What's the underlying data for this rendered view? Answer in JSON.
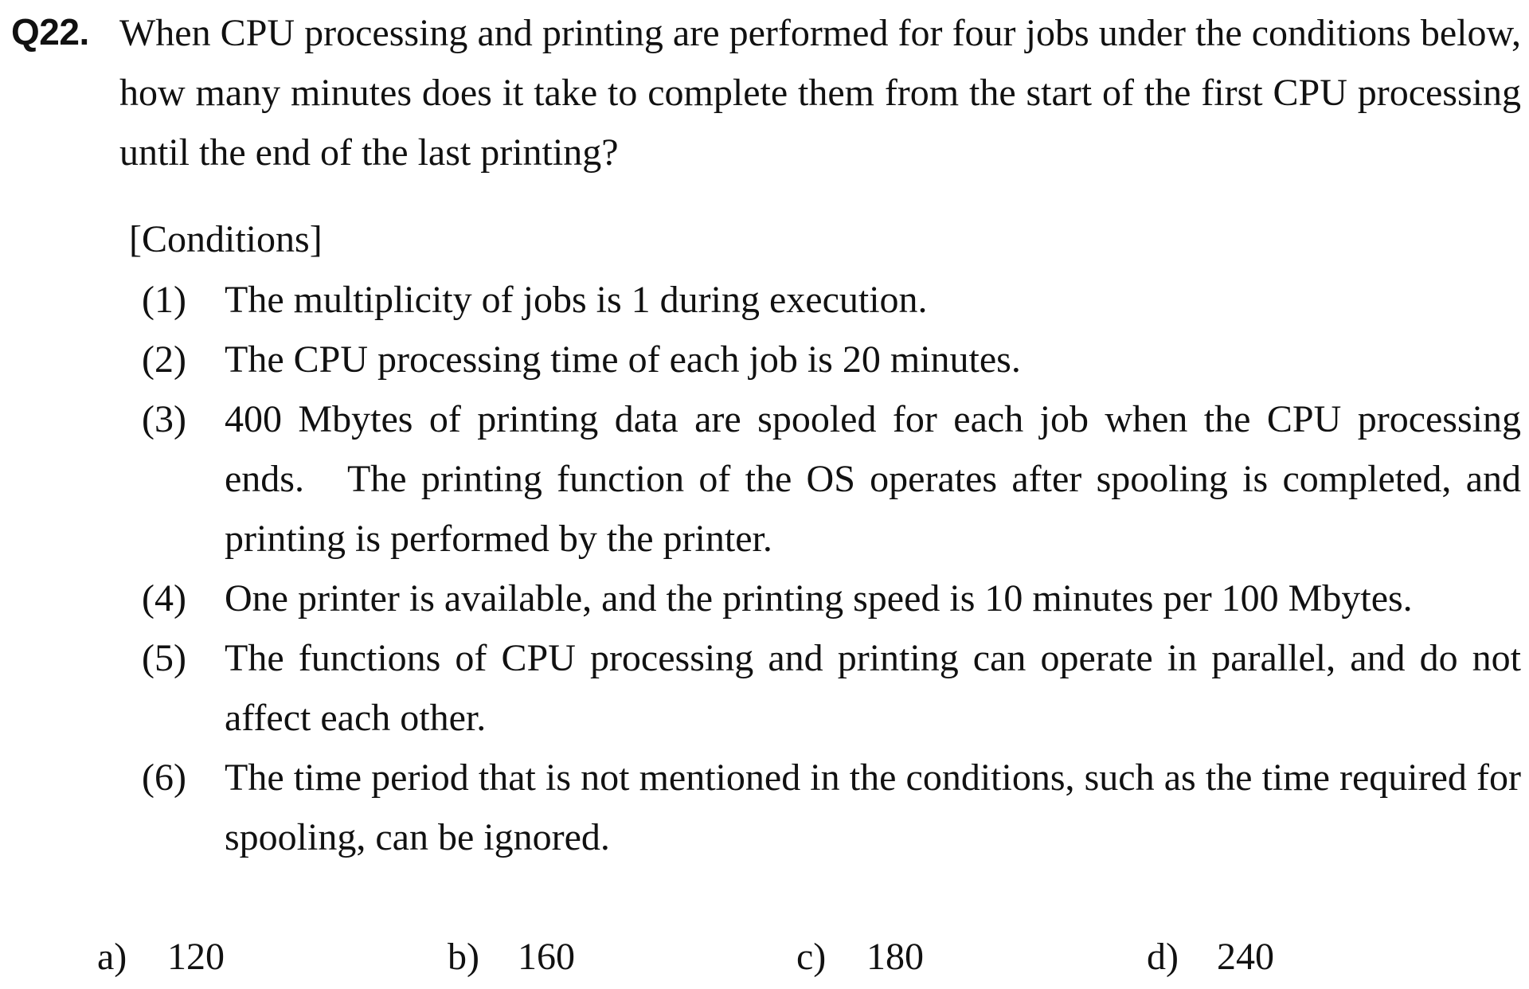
{
  "question": {
    "number": "Q22.",
    "text": "When CPU processing and printing are performed for four jobs under the conditions below, how many minutes does it take to complete them from the start of the first CPU processing until the end of the last printing?"
  },
  "conditions": {
    "heading": "[Conditions]",
    "items": [
      {
        "num": "(1)",
        "text": "The multiplicity of jobs is 1 during execution."
      },
      {
        "num": "(2)",
        "text": "The CPU processing time of each job is 20 minutes."
      },
      {
        "num": "(3)",
        "text": "400 Mbytes of printing data are spooled for each job when the CPU processing ends.   The printing function of the OS operates after spooling is completed, and printing is performed by the printer."
      },
      {
        "num": "(4)",
        "text": "One printer is available, and the printing speed is 10 minutes per 100 Mbytes."
      },
      {
        "num": "(5)",
        "text": "The functions of CPU processing and printing can operate in parallel, and do not affect each other."
      },
      {
        "num": "(6)",
        "text": "The time period that is not mentioned in the conditions, such as the time required for spooling, can be ignored."
      }
    ]
  },
  "choices": [
    {
      "letter": "a)",
      "value": "120"
    },
    {
      "letter": "b)",
      "value": "160"
    },
    {
      "letter": "c)",
      "value": "180"
    },
    {
      "letter": "d)",
      "value": "240"
    }
  ]
}
